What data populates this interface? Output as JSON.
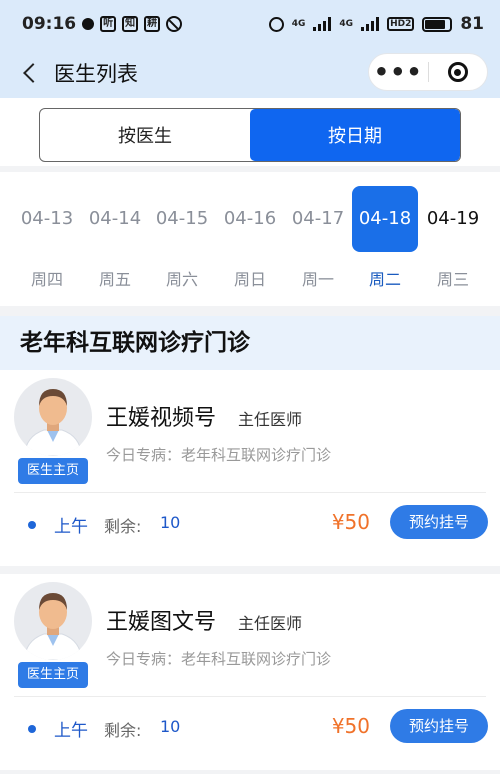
{
  "status_bar": {
    "time": "09:16",
    "app_icons": [
      "chat-bubble-icon",
      "听",
      "知",
      "耕",
      "no-disturb-icon"
    ],
    "network_1": "4G",
    "network_2": "4G",
    "hd_label": "HD2",
    "battery": "81"
  },
  "nav": {
    "title": "医生列表"
  },
  "tabs": [
    {
      "label": "按医生",
      "active": false
    },
    {
      "label": "按日期",
      "active": true
    }
  ],
  "dates": [
    {
      "date": "04-13",
      "weekday": "周四",
      "selected": false
    },
    {
      "date": "04-14",
      "weekday": "周五",
      "selected": false
    },
    {
      "date": "04-15",
      "weekday": "周六",
      "selected": false
    },
    {
      "date": "04-16",
      "weekday": "周日",
      "selected": false
    },
    {
      "date": "04-17",
      "weekday": "周一",
      "selected": false
    },
    {
      "date": "04-18",
      "weekday": "周二",
      "selected": true
    },
    {
      "date": "04-19",
      "weekday": "周三",
      "selected": false
    }
  ],
  "department": "老年科互联网诊疗门诊",
  "doctors": [
    {
      "name": "王媛视频号",
      "title": "主任医师",
      "home_button": "医生主页",
      "specialty": "今日专病：老年科互联网诊疗门诊",
      "period": "上午",
      "remaining_label": "剩余:",
      "remaining": "10",
      "price": "¥50",
      "book_button": "预约挂号"
    },
    {
      "name": "王媛图文号",
      "title": "主任医师",
      "home_button": "医生主页",
      "specialty": "今日专病：老年科互联网诊疗门诊",
      "period": "上午",
      "remaining_label": "剩余:",
      "remaining": "10",
      "price": "¥50",
      "book_button": "预约挂号"
    }
  ],
  "colors": {
    "primary": "#0f66f0",
    "header_bg": "#dbeafa",
    "price": "#f0722a",
    "dept_bg": "#e9f2fc"
  }
}
